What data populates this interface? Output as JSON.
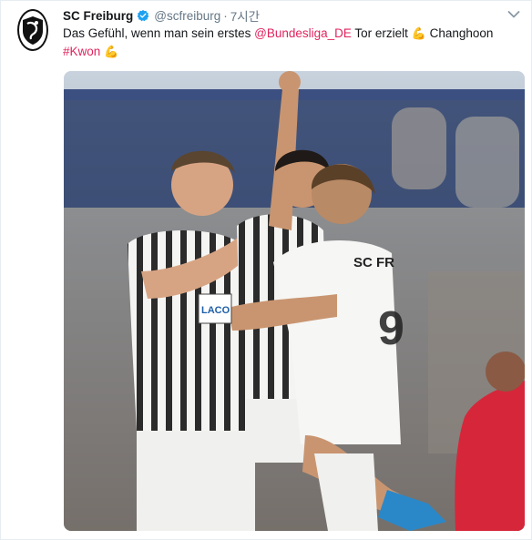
{
  "tweet": {
    "display_name": "SC Freiburg",
    "handle": "@scfreiburg",
    "separator": "·",
    "time": "7시간",
    "text_before_mention": "Das Gefühl, wenn man sein erstes ",
    "mention": "@Bundesliga_DE",
    "text_after_mention": " Tor erzielt ",
    "emoji_1": "💪",
    "text_name": " Changhoon",
    "hashtag": "#Kwon",
    "emoji_2": "💪"
  },
  "photo": {
    "jersey_text": "SC FR",
    "sponsor_text": "LACO"
  },
  "colors": {
    "link": "#e0245e",
    "verified": "#1da1f2",
    "muted": "#657786"
  }
}
